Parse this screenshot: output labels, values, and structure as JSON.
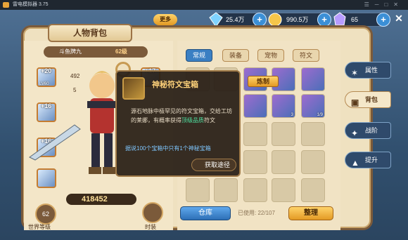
{
  "window": {
    "title": "雷电模拟器 3.75"
  },
  "topbar": {
    "more_label": "更多",
    "diamond": "25.4万",
    "gold": "990.5万",
    "energy": "65",
    "plus": "+",
    "close": "✕"
  },
  "left": {
    "title": "人物背包",
    "name": "斗鱼牌九",
    "level": "62级",
    "stat_hp": "492",
    "stat_def": "5",
    "slots": [
      {
        "plus": "+20",
        "lv": "LV60"
      },
      {
        "plus": "+16"
      },
      {
        "plus": "+16"
      },
      {
        "plus": "+17"
      }
    ],
    "score": "418452",
    "world_level": "62",
    "world_level_label": "世界等级",
    "wardrobe_label": "时装"
  },
  "right": {
    "tabs": [
      "常规",
      "装备",
      "宠物",
      "符文"
    ],
    "refine": "炼制",
    "counts": [
      "3",
      "1/9"
    ],
    "warehouse": "仓库",
    "used_label": "已使用:",
    "used_value": "22/107",
    "sort": "整理"
  },
  "tooltip": {
    "title": "神秘符文宝箱",
    "desc_a": "源石地脉中极罕见的符文宝箱，交给工坊的莱娜，有概率获得",
    "desc_highlight": "顶级品质",
    "desc_b": "符文",
    "note": "据说100个宝箱中只有1个神秘宝箱",
    "path": "获取途径"
  },
  "side": [
    "属性",
    "背包",
    "战阶",
    "提升"
  ]
}
